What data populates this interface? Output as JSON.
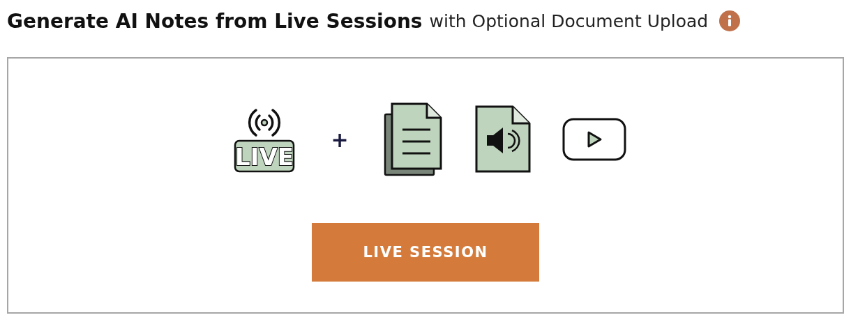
{
  "heading": {
    "title": "Generate AI Notes from Live Sessions",
    "subtitle": "with Optional Document Upload"
  },
  "sources": {
    "live_badge": "LIVE",
    "plus": "+"
  },
  "button": {
    "label": "LIVE SESSION"
  }
}
